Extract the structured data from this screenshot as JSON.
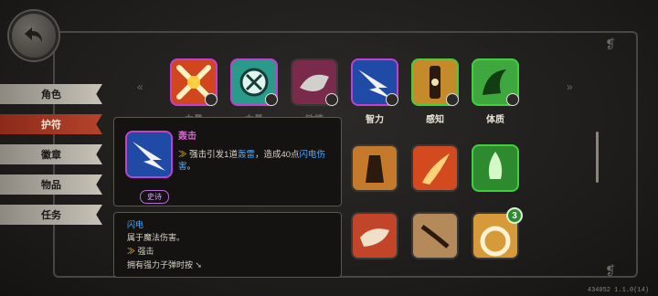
{
  "tabs": [
    {
      "label": "角色",
      "active": false
    },
    {
      "label": "护符",
      "active": true
    },
    {
      "label": "徽章",
      "active": false
    },
    {
      "label": "物品",
      "active": false
    },
    {
      "label": "任务",
      "active": false
    }
  ],
  "top_row_labels": {
    "s1": "力量",
    "s2": "力量",
    "s3": "敏捷",
    "s4": "智力",
    "s5": "感知",
    "s6": "体质"
  },
  "tooltip": {
    "title": "轰击",
    "desc_prefix": "强击引发1道",
    "desc_kw1": "轰雷",
    "desc_mid": "，造成40点",
    "desc_kw2": "闪电伤害",
    "desc_suffix": "。",
    "rarity": "史诗"
  },
  "tooltip2": {
    "keyword": "闪电",
    "line1": "属于魔法伤害。",
    "keyword2": "强击",
    "line2": "拥有强力子弹时按"
  },
  "count_badge": "3",
  "version": "434052 1.1.0(14)",
  "colors": {
    "purple_border": "#c23fd0",
    "green_border": "#3fcf3f",
    "tab_active": "#b5432b"
  }
}
